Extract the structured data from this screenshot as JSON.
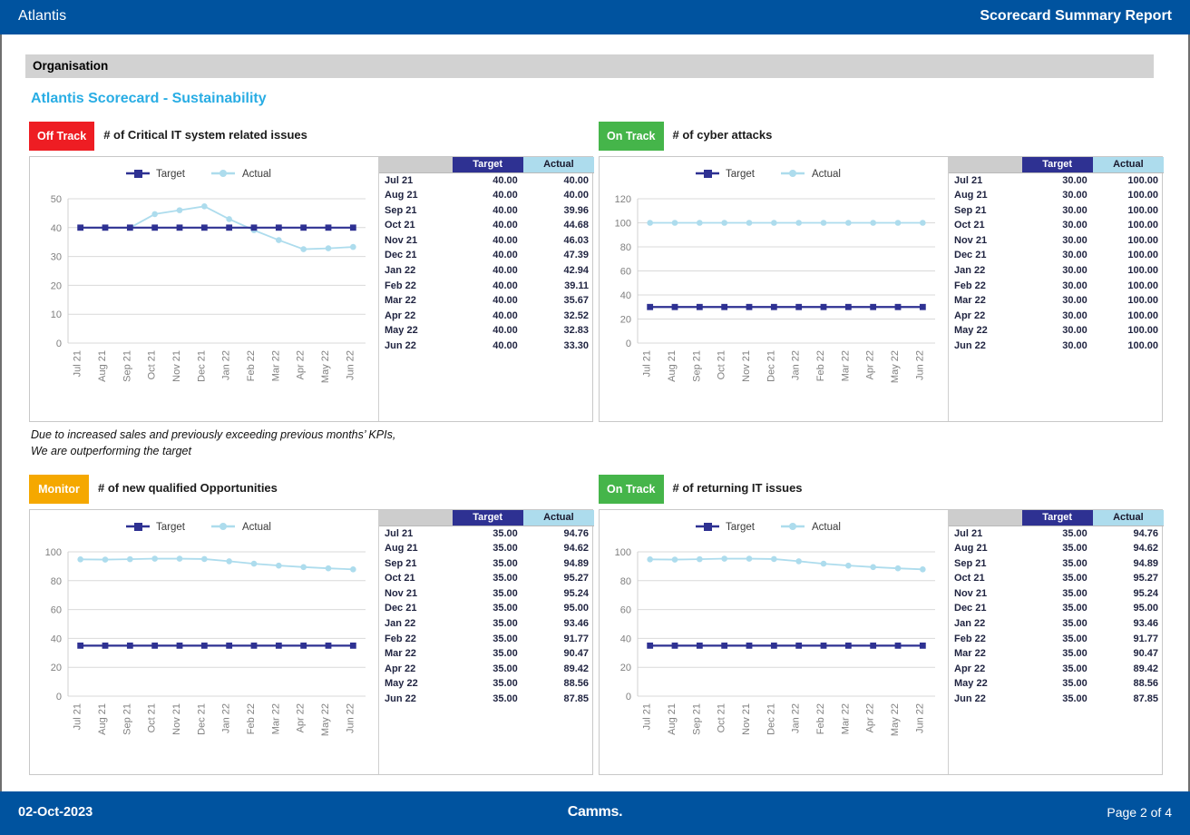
{
  "header": {
    "left_title": "Atlantis",
    "right_title": "Scorecard Summary Report"
  },
  "org_band": {
    "label": "Organisation"
  },
  "scorecard": {
    "title": "Atlantis Scorecard - Sustainability"
  },
  "table_headers": {
    "period": "",
    "target": "Target",
    "actual": "Actual"
  },
  "legend": {
    "target": "Target",
    "actual": "Actual"
  },
  "colors": {
    "header_blue": "#00539f",
    "title_cyan": "#29ade4",
    "off_track_red": "#ee1d23",
    "on_track_green": "#45b54a",
    "monitor_amber": "#f5a800",
    "target_navy": "#2e3192",
    "actual_lightblue": "#addced",
    "band_gray": "#d2d2d2"
  },
  "note": "Due to increased sales and previously exceeding previous months’ KPIs,\nWe are outperforming the target",
  "kpis": [
    {
      "status": "Off Track",
      "status_class": "off",
      "name": "# of Critical IT system related issues",
      "rows": [
        {
          "period": "Jul 21",
          "target": "40.00",
          "actual": "40.00"
        },
        {
          "period": "Aug 21",
          "target": "40.00",
          "actual": "40.00"
        },
        {
          "period": "Sep 21",
          "target": "40.00",
          "actual": "39.96"
        },
        {
          "period": "Oct 21",
          "target": "40.00",
          "actual": "44.68"
        },
        {
          "period": "Nov 21",
          "target": "40.00",
          "actual": "46.03"
        },
        {
          "period": "Dec 21",
          "target": "40.00",
          "actual": "47.39"
        },
        {
          "period": "Jan 22",
          "target": "40.00",
          "actual": "42.94"
        },
        {
          "period": "Feb 22",
          "target": "40.00",
          "actual": "39.11"
        },
        {
          "period": "Mar 22",
          "target": "40.00",
          "actual": "35.67"
        },
        {
          "period": "Apr 22",
          "target": "40.00",
          "actual": "32.52"
        },
        {
          "period": "May 22",
          "target": "40.00",
          "actual": "32.83"
        },
        {
          "period": "Jun 22",
          "target": "40.00",
          "actual": "33.30"
        }
      ]
    },
    {
      "status": "On Track",
      "status_class": "on",
      "name": "# of cyber attacks",
      "rows": [
        {
          "period": "Jul 21",
          "target": "30.00",
          "actual": "100.00"
        },
        {
          "period": "Aug 21",
          "target": "30.00",
          "actual": "100.00"
        },
        {
          "period": "Sep 21",
          "target": "30.00",
          "actual": "100.00"
        },
        {
          "period": "Oct 21",
          "target": "30.00",
          "actual": "100.00"
        },
        {
          "period": "Nov 21",
          "target": "30.00",
          "actual": "100.00"
        },
        {
          "period": "Dec 21",
          "target": "30.00",
          "actual": "100.00"
        },
        {
          "period": "Jan 22",
          "target": "30.00",
          "actual": "100.00"
        },
        {
          "period": "Feb 22",
          "target": "30.00",
          "actual": "100.00"
        },
        {
          "period": "Mar 22",
          "target": "30.00",
          "actual": "100.00"
        },
        {
          "period": "Apr 22",
          "target": "30.00",
          "actual": "100.00"
        },
        {
          "period": "May 22",
          "target": "30.00",
          "actual": "100.00"
        },
        {
          "period": "Jun 22",
          "target": "30.00",
          "actual": "100.00"
        }
      ]
    },
    {
      "status": "Monitor",
      "status_class": "mon",
      "name": "# of new qualified Opportunities",
      "rows": [
        {
          "period": "Jul 21",
          "target": "35.00",
          "actual": "94.76"
        },
        {
          "period": "Aug 21",
          "target": "35.00",
          "actual": "94.62"
        },
        {
          "period": "Sep 21",
          "target": "35.00",
          "actual": "94.89"
        },
        {
          "period": "Oct 21",
          "target": "35.00",
          "actual": "95.27"
        },
        {
          "period": "Nov 21",
          "target": "35.00",
          "actual": "95.24"
        },
        {
          "period": "Dec 21",
          "target": "35.00",
          "actual": "95.00"
        },
        {
          "period": "Jan 22",
          "target": "35.00",
          "actual": "93.46"
        },
        {
          "period": "Feb 22",
          "target": "35.00",
          "actual": "91.77"
        },
        {
          "period": "Mar 22",
          "target": "35.00",
          "actual": "90.47"
        },
        {
          "period": "Apr 22",
          "target": "35.00",
          "actual": "89.42"
        },
        {
          "period": "May 22",
          "target": "35.00",
          "actual": "88.56"
        },
        {
          "period": "Jun 22",
          "target": "35.00",
          "actual": "87.85"
        }
      ]
    },
    {
      "status": "On Track",
      "status_class": "on",
      "name": "# of returning IT issues",
      "rows": [
        {
          "period": "Jul 21",
          "target": "35.00",
          "actual": "94.76"
        },
        {
          "period": "Aug 21",
          "target": "35.00",
          "actual": "94.62"
        },
        {
          "period": "Sep 21",
          "target": "35.00",
          "actual": "94.89"
        },
        {
          "period": "Oct 21",
          "target": "35.00",
          "actual": "95.27"
        },
        {
          "period": "Nov 21",
          "target": "35.00",
          "actual": "95.24"
        },
        {
          "period": "Dec 21",
          "target": "35.00",
          "actual": "95.00"
        },
        {
          "period": "Jan 22",
          "target": "35.00",
          "actual": "93.46"
        },
        {
          "period": "Feb 22",
          "target": "35.00",
          "actual": "91.77"
        },
        {
          "period": "Mar 22",
          "target": "35.00",
          "actual": "90.47"
        },
        {
          "period": "Apr 22",
          "target": "35.00",
          "actual": "89.42"
        },
        {
          "period": "May 22",
          "target": "35.00",
          "actual": "88.56"
        },
        {
          "period": "Jun 22",
          "target": "35.00",
          "actual": "87.85"
        }
      ]
    }
  ],
  "chart_data": [
    {
      "type": "line",
      "title": "# of Critical IT system related issues",
      "xlabel": "",
      "ylabel": "",
      "categories": [
        "Jul 21",
        "Aug 21",
        "Sep 21",
        "Oct 21",
        "Nov 21",
        "Dec 21",
        "Jan 22",
        "Feb 22",
        "Mar 22",
        "Apr 22",
        "May 22",
        "Jun 22"
      ],
      "series": [
        {
          "name": "Target",
          "values": [
            40,
            40,
            40,
            40,
            40,
            40,
            40,
            40,
            40,
            40,
            40,
            40
          ]
        },
        {
          "name": "Actual",
          "values": [
            40,
            40,
            39.96,
            44.68,
            46.03,
            47.39,
            42.94,
            39.11,
            35.67,
            32.52,
            32.83,
            33.3
          ]
        }
      ],
      "ylim": [
        0,
        50
      ],
      "yticks": [
        0,
        10,
        20,
        30,
        40,
        50
      ],
      "grid": true,
      "legend": "top"
    },
    {
      "type": "line",
      "title": "# of cyber attacks",
      "xlabel": "",
      "ylabel": "",
      "categories": [
        "Jul 21",
        "Aug 21",
        "Sep 21",
        "Oct 21",
        "Nov 21",
        "Dec 21",
        "Jan 22",
        "Feb 22",
        "Mar 22",
        "Apr 22",
        "May 22",
        "Jun 22"
      ],
      "series": [
        {
          "name": "Target",
          "values": [
            30,
            30,
            30,
            30,
            30,
            30,
            30,
            30,
            30,
            30,
            30,
            30
          ]
        },
        {
          "name": "Actual",
          "values": [
            100,
            100,
            100,
            100,
            100,
            100,
            100,
            100,
            100,
            100,
            100,
            100
          ]
        }
      ],
      "ylim": [
        0,
        120
      ],
      "yticks": [
        0,
        20,
        40,
        60,
        80,
        100,
        120
      ],
      "grid": true,
      "legend": "top"
    },
    {
      "type": "line",
      "title": "# of new qualified Opportunities",
      "xlabel": "",
      "ylabel": "",
      "categories": [
        "Jul 21",
        "Aug 21",
        "Sep 21",
        "Oct 21",
        "Nov 21",
        "Dec 21",
        "Jan 22",
        "Feb 22",
        "Mar 22",
        "Apr 22",
        "May 22",
        "Jun 22"
      ],
      "series": [
        {
          "name": "Target",
          "values": [
            35,
            35,
            35,
            35,
            35,
            35,
            35,
            35,
            35,
            35,
            35,
            35
          ]
        },
        {
          "name": "Actual",
          "values": [
            94.76,
            94.62,
            94.89,
            95.27,
            95.24,
            95.0,
            93.46,
            91.77,
            90.47,
            89.42,
            88.56,
            87.85
          ]
        }
      ],
      "ylim": [
        0,
        100
      ],
      "yticks": [
        0,
        20,
        40,
        60,
        80,
        100
      ],
      "grid": true,
      "legend": "top"
    },
    {
      "type": "line",
      "title": "# of returning IT issues",
      "xlabel": "",
      "ylabel": "",
      "categories": [
        "Jul 21",
        "Aug 21",
        "Sep 21",
        "Oct 21",
        "Nov 21",
        "Dec 21",
        "Jan 22",
        "Feb 22",
        "Mar 22",
        "Apr 22",
        "May 22",
        "Jun 22"
      ],
      "series": [
        {
          "name": "Target",
          "values": [
            35,
            35,
            35,
            35,
            35,
            35,
            35,
            35,
            35,
            35,
            35,
            35
          ]
        },
        {
          "name": "Actual",
          "values": [
            94.76,
            94.62,
            94.89,
            95.27,
            95.24,
            95.0,
            93.46,
            91.77,
            90.47,
            89.42,
            88.56,
            87.85
          ]
        }
      ],
      "ylim": [
        0,
        100
      ],
      "yticks": [
        0,
        20,
        40,
        60,
        80,
        100
      ],
      "grid": true,
      "legend": "top"
    }
  ],
  "footer": {
    "date": "02-Oct-2023",
    "brand": "Camms.",
    "page": "Page 2 of 4"
  }
}
